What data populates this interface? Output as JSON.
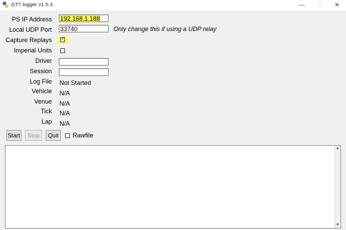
{
  "window": {
    "title": "GT7 logger v1.5.3"
  },
  "form": {
    "ps_ip": {
      "label": "PS IP Address",
      "value": "192.168.1.188",
      "highlight": "#ffff40"
    },
    "udp_port": {
      "label": "Local UDP Port",
      "value": "33740",
      "note": "Only change this if using a UDP relay"
    },
    "capture_replays": {
      "label": "Capture Replays",
      "checked": true
    },
    "imperial_units": {
      "label": "Imperial Units",
      "checked": false
    },
    "driver": {
      "label": "Driver",
      "value": ""
    },
    "session": {
      "label": "Session",
      "value": ""
    },
    "log_file": {
      "label": "Log File",
      "value": "Not Started"
    },
    "vehicle": {
      "label": "Vehicle",
      "value": "N/A"
    },
    "venue": {
      "label": "Venue",
      "value": "N/A"
    },
    "tick": {
      "label": "Tick",
      "value": "N/A"
    },
    "lap": {
      "label": "Lap",
      "value": "N/A"
    }
  },
  "controls": {
    "start_label": "Start",
    "stop_label": "Stop",
    "quit_label": "Quit",
    "rawfile_label": "Rawfile",
    "rawfile_checked": false
  },
  "colors": {
    "highlight": "#ffff40",
    "background": "#f0f0f0"
  }
}
